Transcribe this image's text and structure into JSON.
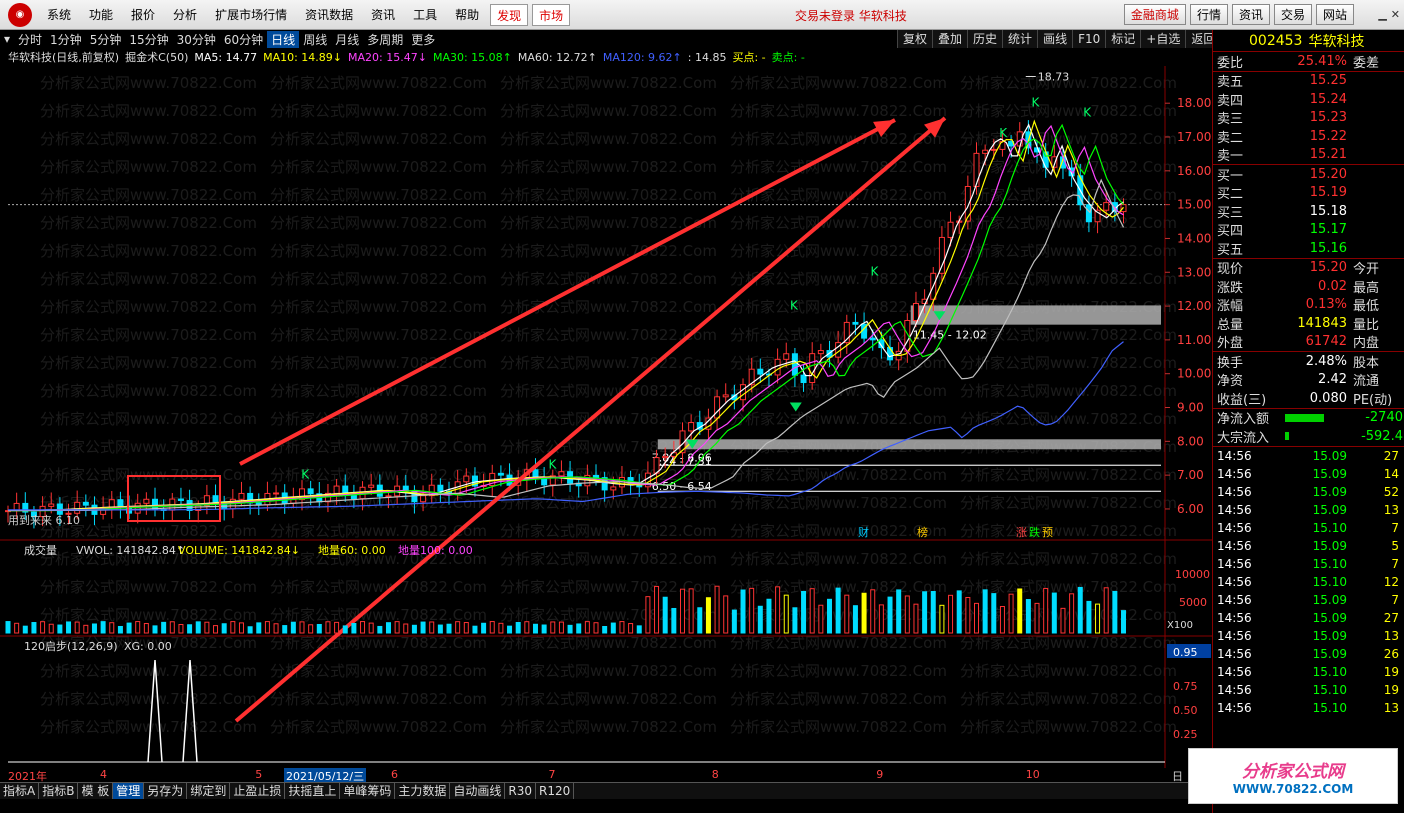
{
  "menubar": {
    "items": [
      "系统",
      "功能",
      "报价",
      "分析",
      "扩展市场行情",
      "资讯数据",
      "资讯",
      "工具",
      "帮助"
    ],
    "red_items": [
      "发现",
      "市场"
    ],
    "center": "交易未登录  华软科技",
    "right_buttons": [
      "金融商城",
      "行情",
      "资讯",
      "交易",
      "网站"
    ]
  },
  "periods": [
    "分时",
    "1分钟",
    "5分钟",
    "15分钟",
    "30分钟",
    "60分钟",
    "日线",
    "周线",
    "月线",
    "多周期",
    "更多"
  ],
  "active_period": "日线",
  "toolbar": [
    "复权",
    "叠加",
    "历史",
    "统计",
    "画线",
    "F10",
    "标记",
    "+自选",
    "返回"
  ],
  "indicator_line": [
    {
      "text": "华软科技(日线,前复权)",
      "color": "#dddddd"
    },
    {
      "text": "掘金术C(50)",
      "color": "#dddddd"
    },
    {
      "text": "MA5: 14.77",
      "color": "#ffffff"
    },
    {
      "text": "MA10: 14.89↓",
      "color": "#ffff00"
    },
    {
      "text": "MA20: 15.47↓",
      "color": "#ff44ff"
    },
    {
      "text": "MA30: 15.08↑",
      "color": "#00ff00"
    },
    {
      "text": "MA60: 12.72↑",
      "color": "#dddddd"
    },
    {
      "text": "MA120: 9.62↑",
      "color": "#4060ff"
    },
    {
      "text": ": 14.85",
      "color": "#dddddd"
    },
    {
      "text": "买点: -",
      "color": "#ffff00"
    },
    {
      "text": "卖点: -",
      "color": "#00ff00"
    }
  ],
  "stock": {
    "code": "002453",
    "name": "华软科技"
  },
  "quote": {
    "weibi": {
      "label": "委比",
      "value": "25.41%",
      "extra": "委差"
    },
    "sell": [
      {
        "label": "卖五",
        "price": "15.25"
      },
      {
        "label": "卖四",
        "price": "15.24"
      },
      {
        "label": "卖三",
        "price": "15.23"
      },
      {
        "label": "卖二",
        "price": "15.22"
      },
      {
        "label": "卖一",
        "price": "15.21"
      }
    ],
    "buy": [
      {
        "label": "买一",
        "price": "15.20",
        "color": "#ff3030"
      },
      {
        "label": "买二",
        "price": "15.19",
        "color": "#ff3030"
      },
      {
        "label": "买三",
        "price": "15.18",
        "color": "#ffffff"
      },
      {
        "label": "买四",
        "price": "15.17",
        "color": "#00ff00"
      },
      {
        "label": "买五",
        "price": "15.16",
        "color": "#00ff00"
      }
    ],
    "stats1": [
      {
        "label": "现价",
        "value": "15.20",
        "extra": "今开",
        "color": "#ff3030"
      },
      {
        "label": "涨跌",
        "value": "0.02",
        "extra": "最高",
        "color": "#ff3030"
      },
      {
        "label": "涨幅",
        "value": "0.13%",
        "extra": "最低",
        "color": "#ff3030"
      },
      {
        "label": "总量",
        "value": "141843",
        "extra": "量比",
        "color": "#ffff00"
      },
      {
        "label": "外盘",
        "value": "61742",
        "extra": "内盘",
        "color": "#ff3030"
      }
    ],
    "stats2": [
      {
        "label": "换手",
        "value": "2.48%",
        "extra": "股本",
        "color": "#ffffff"
      },
      {
        "label": "净资",
        "value": "2.42",
        "extra": "流通",
        "color": "#ffffff"
      },
      {
        "label": "收益(三)",
        "value": "0.080",
        "extra": "PE(动)",
        "color": "#ffffff"
      }
    ],
    "flow": [
      {
        "label": "净流入额",
        "value": "-2740",
        "fill": 0.65
      },
      {
        "label": "大宗流入",
        "value": "-592.4",
        "fill": 0.06
      }
    ]
  },
  "ticks": [
    {
      "time": "14:56",
      "price": "15.09",
      "vol": "27"
    },
    {
      "time": "14:56",
      "price": "15.09",
      "vol": "14"
    },
    {
      "time": "14:56",
      "price": "15.09",
      "vol": "52"
    },
    {
      "time": "14:56",
      "price": "15.09",
      "vol": "13"
    },
    {
      "time": "14:56",
      "price": "15.10",
      "vol": "7"
    },
    {
      "time": "14:56",
      "price": "15.09",
      "vol": "5"
    },
    {
      "time": "14:56",
      "price": "15.10",
      "vol": "7"
    },
    {
      "time": "14:56",
      "price": "15.10",
      "vol": "12"
    },
    {
      "time": "14:56",
      "price": "15.09",
      "vol": "7"
    },
    {
      "time": "14:56",
      "price": "15.09",
      "vol": "27"
    },
    {
      "time": "14:56",
      "price": "15.09",
      "vol": "13"
    },
    {
      "time": "14:56",
      "price": "15.09",
      "vol": "26"
    },
    {
      "time": "14:56",
      "price": "15.10",
      "vol": "19"
    },
    {
      "time": "14:56",
      "price": "15.10",
      "vol": "19"
    },
    {
      "time": "14:56",
      "price": "15.10",
      "vol": "13"
    }
  ],
  "price_axis": [
    18,
    17,
    16,
    15,
    14,
    13,
    12,
    11,
    10,
    9,
    8,
    7,
    6
  ],
  "price_range": [
    5.2,
    19.1
  ],
  "high_label": "18.73",
  "zones": [
    {
      "label": "11.45 - 12.02",
      "low": 11.45,
      "high": 12.02
    },
    {
      "label": "7.81 - 8.06",
      "low": 7.81,
      "high": 8.06
    },
    {
      "label": "7.24 - 7.31",
      "low": 7.24,
      "high": 7.31
    },
    {
      "label": "6.50 - 6.54",
      "low": 6.5,
      "high": 6.54
    }
  ],
  "current_price": 15.0,
  "annotation_left": "用到来来 6.10",
  "event_tags": [
    {
      "text": "财",
      "color": "#00ccff"
    },
    {
      "text": "榜",
      "color": "#ffcc00"
    },
    {
      "text": "涨",
      "color": "#ff4444"
    },
    {
      "text": "跌",
      "color": "#00ff00"
    },
    {
      "text": "预",
      "color": "#ffcc00"
    }
  ],
  "volume_panel": {
    "title": "成交量",
    "vwol": "VWOL: 141842.84↑",
    "volume": "VOLUME: 141842.84↓",
    "diliang60": "地量60: 0.00",
    "diliang100": "地量100: 0.00",
    "axis": [
      "10000",
      "5000"
    ],
    "unit": "X100"
  },
  "bottom_panel": {
    "title": "120启步(12,26,9)",
    "xg": "XG: 0.00",
    "axis": [
      "0.95",
      "0.75",
      "0.50",
      "0.25"
    ]
  },
  "date_axis": [
    {
      "text": "2021年",
      "frac": 0.0
    },
    {
      "text": "4",
      "frac": 0.08
    },
    {
      "text": "5",
      "frac": 0.215
    },
    {
      "text": "2021/05/12/三",
      "frac": 0.24
    },
    {
      "text": "6",
      "frac": 0.333
    },
    {
      "text": "7",
      "frac": 0.47
    },
    {
      "text": "8",
      "frac": 0.612
    },
    {
      "text": "9",
      "frac": 0.755
    },
    {
      "text": "10",
      "frac": 0.885
    }
  ],
  "date_axis_right": "日",
  "bottom_tabs": [
    "指标A",
    "指标B",
    "模 板",
    "管理",
    "另存为",
    "绑定到",
    "止盈止损",
    "扶摇直上",
    "单峰筹码",
    "主力数据",
    "自动画线",
    "R30",
    "R120"
  ],
  "active_tab": "管理",
  "watermark": {
    "line1": "分析家公式网",
    "line2": "WWW.70822.COM"
  },
  "chart_data": {
    "type": "candlestick",
    "title": "华软科技(日线,前复权)",
    "ylim": [
      5.2,
      19.1
    ],
    "high": 18.73,
    "ma": [
      {
        "name": "MA5",
        "value": 14.77,
        "color": "#ffffff"
      },
      {
        "name": "MA10",
        "value": 14.89,
        "color": "#ffff00"
      },
      {
        "name": "MA20",
        "value": 15.47,
        "color": "#ff44ff"
      },
      {
        "name": "MA30",
        "value": 15.08,
        "color": "#00ff00"
      },
      {
        "name": "MA60",
        "value": 12.72,
        "color": "#c0c0c0"
      },
      {
        "name": "MA120",
        "value": 9.62,
        "color": "#4060ff"
      }
    ],
    "price_path": [
      [
        0,
        5.95
      ],
      [
        0.04,
        5.98
      ],
      [
        0.08,
        6.05
      ],
      [
        0.12,
        6.1
      ],
      [
        0.16,
        6.15
      ],
      [
        0.2,
        6.25
      ],
      [
        0.24,
        6.35
      ],
      [
        0.28,
        6.45
      ],
      [
        0.32,
        6.55
      ],
      [
        0.36,
        6.4
      ],
      [
        0.38,
        6.6
      ],
      [
        0.4,
        6.8
      ],
      [
        0.43,
        6.9
      ],
      [
        0.46,
        6.95
      ],
      [
        0.48,
        6.9
      ],
      [
        0.5,
        6.85
      ],
      [
        0.52,
        6.75
      ],
      [
        0.54,
        6.7
      ],
      [
        0.56,
        7.1
      ],
      [
        0.57,
        7.6
      ],
      [
        0.58,
        7.9
      ],
      [
        0.59,
        8.3
      ],
      [
        0.6,
        8.5
      ],
      [
        0.62,
        9.2
      ],
      [
        0.64,
        9.7
      ],
      [
        0.66,
        10.2
      ],
      [
        0.68,
        10.4
      ],
      [
        0.69,
        9.8
      ],
      [
        0.7,
        10.4
      ],
      [
        0.72,
        10.9
      ],
      [
        0.74,
        11.6
      ],
      [
        0.75,
        11.0
      ],
      [
        0.76,
        10.5
      ],
      [
        0.77,
        10.6
      ],
      [
        0.78,
        11.2
      ],
      [
        0.8,
        12.7
      ],
      [
        0.81,
        13.5
      ],
      [
        0.82,
        14.5
      ],
      [
        0.83,
        15.0
      ],
      [
        0.84,
        16.0
      ],
      [
        0.85,
        16.8
      ],
      [
        0.86,
        17.0
      ],
      [
        0.87,
        16.2
      ],
      [
        0.88,
        17.5
      ],
      [
        0.89,
        16.6
      ],
      [
        0.9,
        15.8
      ],
      [
        0.91,
        16.8
      ],
      [
        0.92,
        15.8
      ],
      [
        0.93,
        15.2
      ],
      [
        0.94,
        14.8
      ],
      [
        0.95,
        14.6
      ],
      [
        0.96,
        15.0
      ],
      [
        0.97,
        15.2
      ]
    ]
  }
}
